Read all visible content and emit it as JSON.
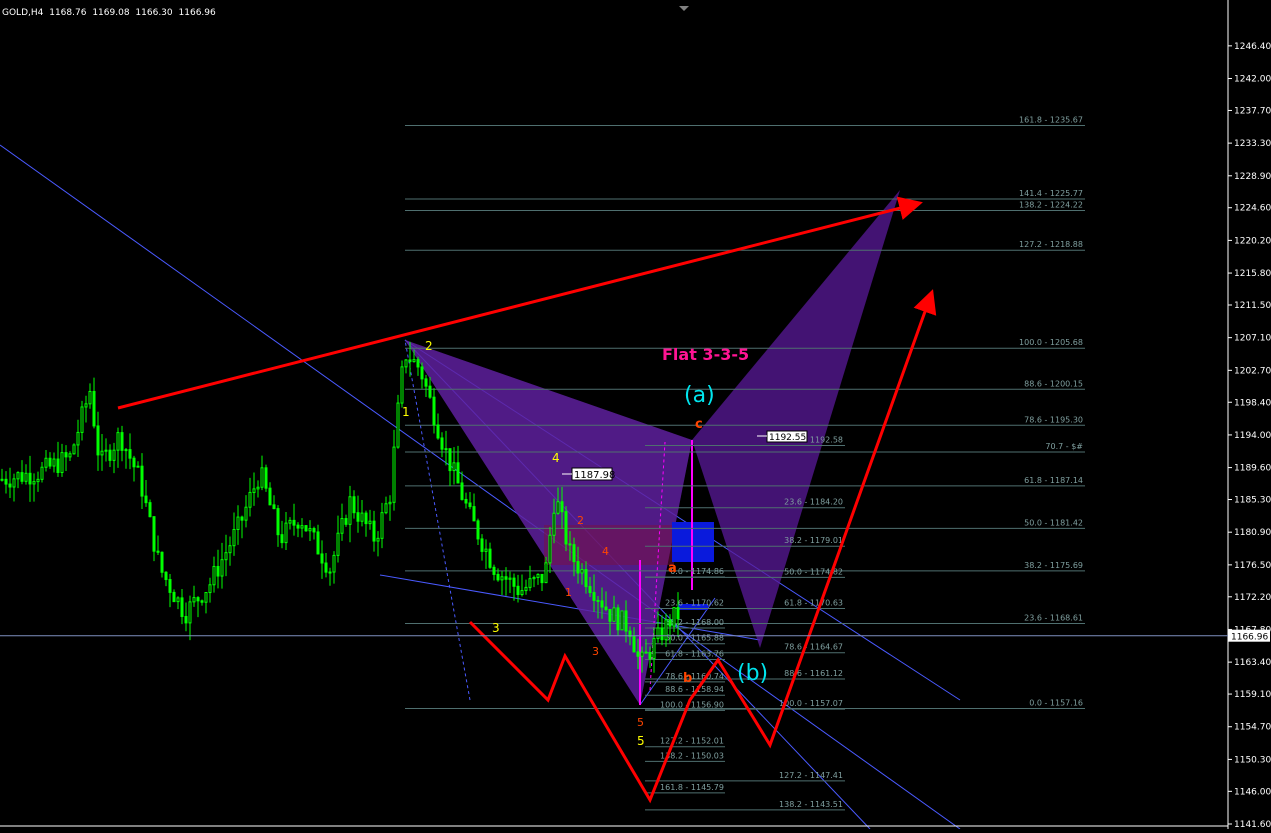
{
  "header": {
    "symbol": "GOLD,H4",
    "open": "1168.76",
    "high": "1169.08",
    "low": "1166.30",
    "close": "1166.96"
  },
  "chart_data": {
    "type": "candlestick",
    "symbol": "GOLD",
    "timeframe": "H4",
    "ylim": [
      1141.6,
      1248.4
    ],
    "y_axis_ticks": [
      "1246.40",
      "1242.00",
      "1237.70",
      "1233.30",
      "1228.90",
      "1224.60",
      "1220.20",
      "1215.80",
      "1211.50",
      "1207.10",
      "1202.70",
      "1198.40",
      "1194.00",
      "1189.60",
      "1185.30",
      "1180.90",
      "1176.50",
      "1172.20",
      "1167.80",
      "1163.40",
      "1159.10",
      "1154.70",
      "1150.30",
      "1146.00",
      "1141.60"
    ],
    "current_price": "1166.96",
    "colors": {
      "bull": "#00ff00",
      "bear": "#00ff00",
      "background": "#000000",
      "axis_text": "#ffffff",
      "fib_line": "#4f6f6f",
      "fib_text": "#7f9f9f",
      "red_path": "#ff0000",
      "butterfly": "#5a1a9a",
      "trend_line": "#4a5aff",
      "title": "#ff1493",
      "wave_a": "#00e5ee"
    },
    "candles_approx": [
      {
        "t": 0,
        "o": 1188,
        "h": 1190,
        "l": 1186,
        "c": 1189
      },
      {
        "t": 1,
        "o": 1189,
        "h": 1191,
        "l": 1187,
        "c": 1188
      },
      {
        "t": 2,
        "o": 1188,
        "h": 1190,
        "l": 1185,
        "c": 1189
      }
    ],
    "annotations": {
      "title": "Flat 3-3-5",
      "wave_a_big": "(a)",
      "wave_b_big": "(b)",
      "small_c": "c",
      "small_a": "a",
      "small_b": "b",
      "wave_nums_yellow": [
        "1",
        "2",
        "3",
        "4",
        "5"
      ],
      "wave_nums_orange": [
        "1",
        "2",
        "3",
        "4",
        "5"
      ],
      "price_tags": [
        "1187.98",
        "1192.55"
      ]
    },
    "fib_right": [
      {
        "label": "161.8 - 1235.67",
        "y": 1235.67
      },
      {
        "label": "141.4 - 1225.77",
        "y": 1225.77
      },
      {
        "label": "138.2 - 1224.22",
        "y": 1224.22
      },
      {
        "label": "127.2 - 1218.88",
        "y": 1218.88
      },
      {
        "label": "100.0 - 1205.68",
        "y": 1205.68
      },
      {
        "label": "88.6 - 1200.15",
        "y": 1200.15
      },
      {
        "label": "78.6 - 1195.30",
        "y": 1195.3
      },
      {
        "label": "70.7 - $#",
        "y": 1191.7
      },
      {
        "label": "61.8 - 1187.14",
        "y": 1187.14
      },
      {
        "label": "50.0 - 1181.42",
        "y": 1181.42
      },
      {
        "label": "38.2 - 1175.69",
        "y": 1175.69
      },
      {
        "label": "23.6 - 1168.61",
        "y": 1168.61
      },
      {
        "label": "0.0 - 1157.16",
        "y": 1157.16
      }
    ],
    "fib_mid": [
      {
        "label": "0.0 - 1192.58",
        "y": 1192.58
      },
      {
        "label": "23.6 - 1184.20",
        "y": 1184.2
      },
      {
        "label": "38.2 - 1179.01",
        "y": 1179.01
      },
      {
        "label": "50.0 - 1174.82",
        "y": 1174.82
      },
      {
        "label": "61.8 - 1170.63",
        "y": 1170.63
      },
      {
        "label": "78.6 - 1164.67",
        "y": 1164.67
      },
      {
        "label": "88.6 - 1161.12",
        "y": 1161.12
      },
      {
        "label": "100.0 - 1157.07",
        "y": 1157.07
      },
      {
        "label": "127.2 - 1147.41",
        "y": 1147.41
      },
      {
        "label": "138.2 - 1143.51",
        "y": 1143.51
      }
    ],
    "fib_left": [
      {
        "label": "0.0 - 1174.86",
        "y": 1174.86
      },
      {
        "label": "23.6 - 1170.62",
        "y": 1170.62
      },
      {
        "label": "38.2 - 1168.00",
        "y": 1168.0
      },
      {
        "label": "50.0 - 1165.88",
        "y": 1165.88
      },
      {
        "label": "61.8 - 1163.76",
        "y": 1163.76
      },
      {
        "label": "78.6 - 1160.74",
        "y": 1160.74
      },
      {
        "label": "88.6 - 1158.94",
        "y": 1158.94
      },
      {
        "label": "100.0 - 1156.90",
        "y": 1156.9
      },
      {
        "label": "127.2 - 1152.01",
        "y": 1152.01
      },
      {
        "label": "138.2 - 1150.03",
        "y": 1150.03
      },
      {
        "label": "161.8 - 1145.79",
        "y": 1145.79
      }
    ]
  }
}
